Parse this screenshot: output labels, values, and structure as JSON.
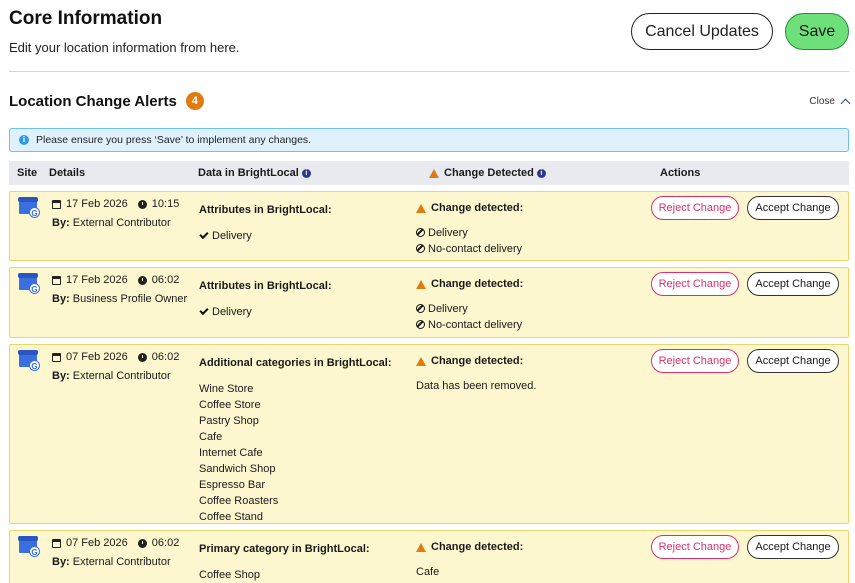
{
  "header": {
    "title": "Core Information",
    "subtitle": "Edit your location information from here.",
    "cancel_label": "Cancel Updates",
    "save_label": "Save"
  },
  "alerts": {
    "title": "Location Change Alerts",
    "count": "4",
    "close_label": "Close",
    "info_text": "Please ensure you press ‘Save’ to implement any changes."
  },
  "table": {
    "headers": {
      "site": "Site",
      "details": "Details",
      "data": "Data in BrightLocal",
      "change": "Change Detected",
      "actions": "Actions"
    },
    "rows": [
      {
        "date": "17 Feb 2026",
        "time": "10:15",
        "by_label": "By:",
        "by": "External Contributor",
        "data_title": "Attributes in BrightLocal:",
        "data_items": [
          "Delivery"
        ],
        "change_title": "Change detected:",
        "change_items": [
          "Delivery",
          "No-contact delivery"
        ],
        "reject_label": "Reject Change",
        "accept_label": "Accept Change"
      },
      {
        "date": "17 Feb 2026",
        "time": "06:02",
        "by_label": "By:",
        "by": "Business Profile Owner",
        "data_title": "Attributes in BrightLocal:",
        "data_items": [
          "Delivery"
        ],
        "change_title": "Change detected:",
        "change_items": [
          "Delivery",
          "No-contact delivery"
        ],
        "reject_label": "Reject Change",
        "accept_label": "Accept Change"
      },
      {
        "date": "07 Feb 2026",
        "time": "06:02",
        "by_label": "By:",
        "by": "External Contributor",
        "data_title": "Additional categories in BrightLocal:",
        "data_items": [
          "Wine Store",
          "Coffee Store",
          "Pastry Shop",
          "Cafe",
          "Internet Cafe",
          "Sandwich Shop",
          "Espresso Bar",
          "Coffee Roasters",
          "Coffee Stand"
        ],
        "change_title": "Change detected:",
        "change_text": "Data has been removed.",
        "reject_label": "Reject Change",
        "accept_label": "Accept Change"
      },
      {
        "date": "07 Feb 2026",
        "time": "06:02",
        "by_label": "By:",
        "by": "External Contributor",
        "data_title": "Primary category in BrightLocal:",
        "data_items": [
          "Coffee Shop"
        ],
        "change_title": "Change detected:",
        "change_text": "Cafe",
        "reject_label": "Reject Change",
        "accept_label": "Accept Change"
      }
    ]
  },
  "colors": {
    "row_bg": "#fdf7cf",
    "row_border": "#ecd66b",
    "accent_warning": "#e07b12",
    "save_green": "#6ee07a",
    "reject_pink": "#d9326b",
    "info_blue": "#2f9be0"
  },
  "icons": {
    "site": "google-business-icon",
    "date": "calendar-icon",
    "time": "clock-icon",
    "warning": "warning-triangle-icon",
    "info": "info-circle-icon",
    "check": "check-icon",
    "ban": "ban-icon",
    "close": "chevron-up-icon"
  }
}
